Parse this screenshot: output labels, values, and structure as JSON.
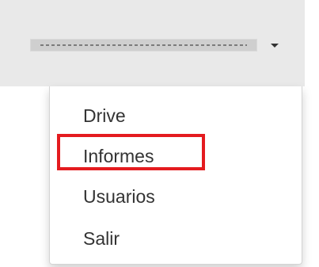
{
  "header": {
    "user_name": "[redacted]"
  },
  "menu": {
    "items": [
      {
        "label": "Drive"
      },
      {
        "label": "Informes"
      },
      {
        "label": "Usuarios"
      },
      {
        "label": "Salir"
      }
    ],
    "highlighted_index": 1
  },
  "colors": {
    "topbar_bg": "#e9e9e9",
    "highlight_border": "#e41b1f",
    "menu_text": "#333333"
  }
}
